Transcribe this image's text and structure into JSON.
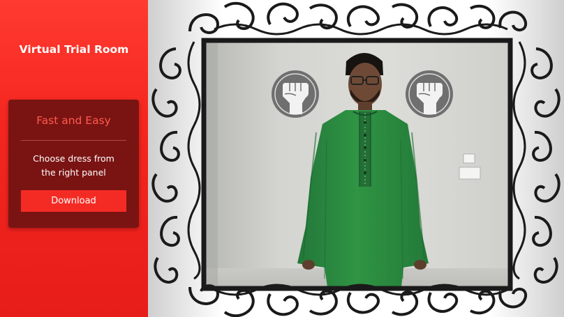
{
  "sidebar": {
    "title": "Virtual Trial Room",
    "card": {
      "heading": "Fast and Easy",
      "description_line1": "Choose dress from",
      "description_line2": "the right panel",
      "download_button": "Download"
    }
  },
  "colors": {
    "sidebar_red": "#f4261f",
    "card_dark_red": "#7a1413",
    "heading_red": "#ff5a4c",
    "kurta_green": "#2f8f3f",
    "frame_black": "#1a1a1a"
  },
  "icons": [
    "raised-fist-icon",
    "raised-fist-icon"
  ]
}
